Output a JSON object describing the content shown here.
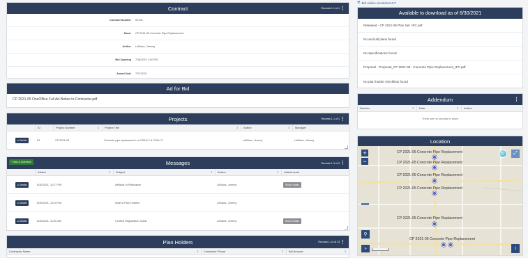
{
  "contract": {
    "title": "Contract",
    "records": "Records 1-1 of 1",
    "fields": [
      {
        "label": "Contract Number",
        "value": "02105"
      },
      {
        "label": "Name",
        "value": "CP 2021-05 Concrete Pipe Replacement"
      },
      {
        "label": "Author",
        "value": "LeBlanc, Jeremy"
      },
      {
        "label": "Bid Opening",
        "value": "7/26/2021 2:00 PM"
      },
      {
        "label": "Award Date",
        "value": "7/27/2021"
      }
    ]
  },
  "ad_for_bid": {
    "title": "Ad for Bid",
    "file": "CP 2021-05 OneOffice Full Ad-Notice to Contractor.pdf"
  },
  "projects": {
    "title": "Projects",
    "records": "Records 1-1 of 1",
    "columns": [
      "ID",
      "Project Number",
      "Project Title",
      "Author",
      "Manager"
    ],
    "rows": [
      {
        "details": "Details",
        "id": "64",
        "number": "CP 2021-05",
        "project_title": "Concrete pipe replacement on CSAH 2 & CSAH 3",
        "author": "LeBlanc, Jeremy",
        "manager": "LeBlanc, Jeremy"
      }
    ]
  },
  "messages": {
    "title": "Messages",
    "records": "Records 1-3 of 3",
    "ask_button": "+ Ask a Question",
    "columns": [
      "Added",
      "Subject",
      "Author",
      "Attachments"
    ],
    "rows": [
      {
        "details": "Details",
        "added": "6/30/2021, 12:27 PM",
        "subject": "Affidavit of Publication",
        "author": "LeBlanc, Jeremy",
        "attachments": "Show Details"
      },
      {
        "details": "Details",
        "added": "6/30/2021, 12:09 PM",
        "subject": "Note to Plan Holders",
        "author": "LeBlanc, Jeremy",
        "attachments": ""
      },
      {
        "details": "Details",
        "added": "6/30/2021, 11:50 AM",
        "subject": "Contest Registration Guide",
        "author": "LeBlanc, Jeremy",
        "attachments": "Show Details"
      }
    ]
  },
  "plan_holders": {
    "title": "Plan Holders",
    "records": "Records 1-13 of 13",
    "columns": [
      "Contractor Name",
      "Contractor Phone",
      "Bid Amount"
    ]
  },
  "bidvault": {
    "link": "Bid online via BidVAULT"
  },
  "downloads": {
    "title": "Available to download as of 6/30/2021",
    "items": [
      "Released - CP 2021-05 Plan Set -IFC.pdf",
      "No as-built plans found",
      "No specifications found",
      "Proposal - Proposal_CP 2021-05 - Concrete Pipe Replacement_IFC.pdf",
      "No plan holder checklists found"
    ]
  },
  "addendum": {
    "title": "Addendum",
    "columns": [
      "Number",
      "Date",
      "Author"
    ],
    "empty": "There are no records to show"
  },
  "location": {
    "title": "Location",
    "labels": [
      "CP 2021-05 Concrete Pipe Replacement",
      "CP 2021-05 Concrete Pipe Replacement",
      "CP 2021-05 Concrete Pipe Replacement",
      "CP 2021-05 Concrete Pipe Replacement",
      "CP 2021-05 Concrete Pipe Replacement",
      "CP 2021-05 Concrete Pipe Replacement"
    ]
  },
  "colors": {
    "header": "#2c3e5c",
    "accent_green": "#2e7d32",
    "pin": "#4a56c8"
  },
  "icons": {
    "kebab": "kebab-menu-icon",
    "zoom_in": "plus-icon",
    "zoom_out": "minus-icon",
    "search": "search-icon",
    "layers": "globe-icon",
    "fullscreen": "expand-icon",
    "info": "info-icon",
    "forward": "double-chevron-icon"
  }
}
